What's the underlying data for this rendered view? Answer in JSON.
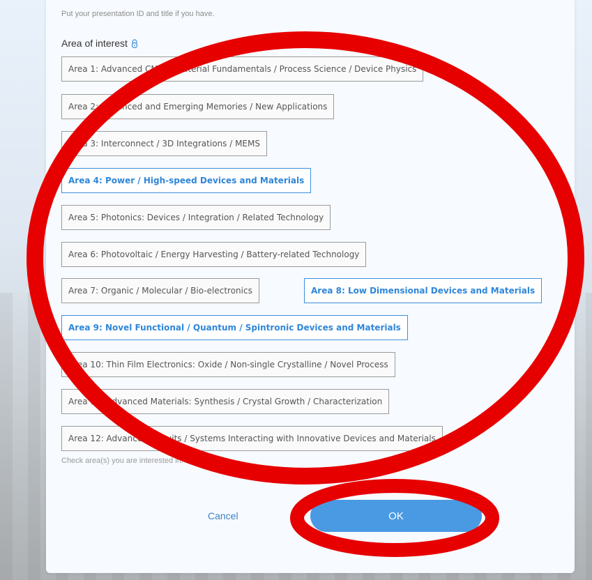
{
  "form": {
    "hint_top": "Put your presentation ID and title if you have.",
    "area_label": "Area of interest",
    "lock_icon": "lock-icon",
    "areas": [
      {
        "label": "Area 1: Advanced CMOS: Material Fundamentals / Process Science / Device Physics",
        "selected": false
      },
      {
        "label": "Area 2: Advanced and Emerging Memories / New Applications",
        "selected": false
      },
      {
        "label": "Area 3: Interconnect / 3D Integrations / MEMS",
        "selected": false
      },
      {
        "label": "Area 4: Power / High-speed Devices and Materials",
        "selected": true
      },
      {
        "label": "Area 5: Photonics: Devices / Integration / Related Technology",
        "selected": false
      },
      {
        "label": "Area 6: Photovoltaic / Energy Harvesting / Battery-related Technology",
        "selected": false
      },
      {
        "label": "Area 7: Organic / Molecular / Bio-electronics",
        "selected": false
      },
      {
        "label": "Area 8: Low Dimensional Devices and Materials",
        "selected": true
      },
      {
        "label": "Area 9: Novel Functional / Quantum / Spintronic Devices and Materials",
        "selected": true
      },
      {
        "label": "Area 10: Thin Film Electronics: Oxide / Non-single Crystalline / Novel Process",
        "selected": false
      },
      {
        "label": "Area 11: Advanced Materials: Synthesis / Crystal Growth / Characterization",
        "selected": false
      },
      {
        "label": "Area 12: Advanced Circuits / Systems Interacting with Innovative Devices and Materials",
        "selected": false
      }
    ],
    "hint_bottom": "Check area(s) you are interested in.",
    "cancel_label": "Cancel",
    "ok_label": "OK"
  },
  "colors": {
    "accent": "#4a9ae3",
    "selected_border": "#3d8fdc",
    "annotation_red": "#e60000"
  }
}
